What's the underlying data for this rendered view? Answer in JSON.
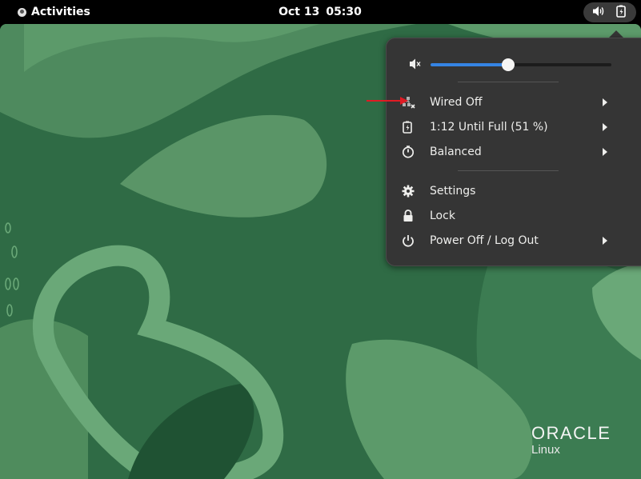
{
  "topbar": {
    "activities_label": "Activities",
    "date": "Oct 13",
    "time": "05:30",
    "tray_icons": [
      "volume-icon",
      "battery-charging-icon"
    ]
  },
  "quick_menu": {
    "volume": {
      "icon": "volume-muted-icon",
      "level": 0.43
    },
    "items_group1": [
      {
        "icon": "wired-network-off-icon",
        "label": "Wired Off",
        "has_submenu": true
      },
      {
        "icon": "battery-charging-icon",
        "label": "1:12 Until Full (51 %)",
        "has_submenu": true
      },
      {
        "icon": "power-profile-icon",
        "label": "Balanced",
        "has_submenu": true
      }
    ],
    "items_group2": [
      {
        "icon": "settings-gear-icon",
        "label": "Settings",
        "has_submenu": false
      },
      {
        "icon": "lock-icon",
        "label": "Lock",
        "has_submenu": false
      },
      {
        "icon": "power-icon",
        "label": "Power Off / Log Out",
        "has_submenu": true
      }
    ]
  },
  "desktop": {
    "brand_line1": "ORACLE",
    "brand_line2": "Linux"
  },
  "colors": {
    "accent": "#3584e4",
    "menu_bg": "#353535",
    "wallpaper_green": "#2f6e47",
    "annotation_arrow": "#e01b24"
  }
}
